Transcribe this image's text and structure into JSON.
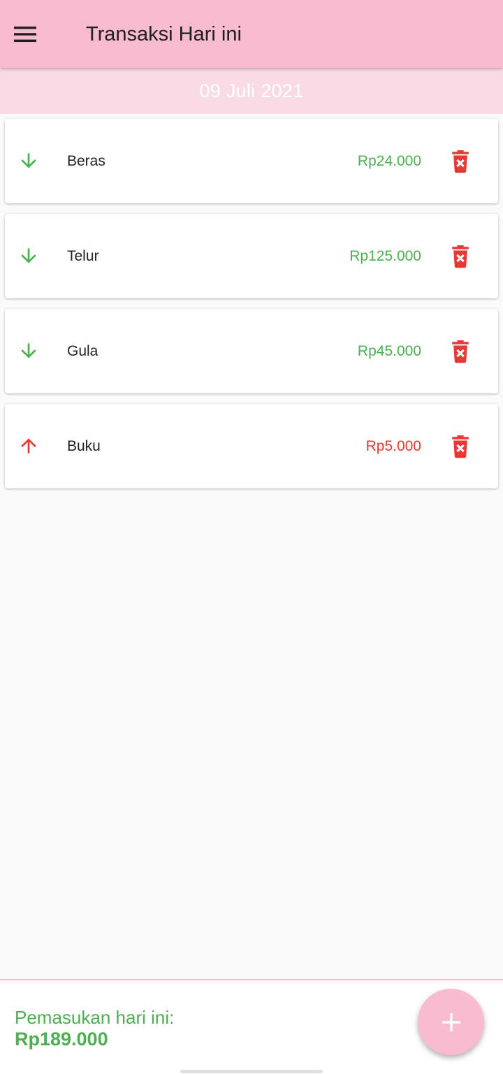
{
  "app_bar": {
    "title": "Transaksi Hari ini",
    "menu_icon": "hamburger-menu-icon",
    "background": "#f8bbd0"
  },
  "date_bar": {
    "date": "09 Juli 2021",
    "background": "#f8dbe4"
  },
  "transactions": [
    {
      "name": "Beras",
      "amount": "Rp24.000",
      "direction": "down",
      "icon": "arrow-down-icon",
      "color": "#4caf50"
    },
    {
      "name": "Telur",
      "amount": "Rp125.000",
      "direction": "down",
      "icon": "arrow-down-icon",
      "color": "#4caf50"
    },
    {
      "name": "Gula",
      "amount": "Rp45.000",
      "direction": "down",
      "icon": "arrow-down-icon",
      "color": "#4caf50"
    },
    {
      "name": "Buku",
      "amount": "Rp5.000",
      "direction": "up",
      "icon": "arrow-up-icon",
      "color": "#e53935"
    }
  ],
  "delete_icon": "trash-delete-icon",
  "delete_color": "#e53935",
  "footer": {
    "label": "Pemasukan hari ini:",
    "total": "Rp189.000",
    "color": "#4caf50"
  },
  "fab": {
    "icon": "plus-icon",
    "background": "#f8bbd0"
  }
}
